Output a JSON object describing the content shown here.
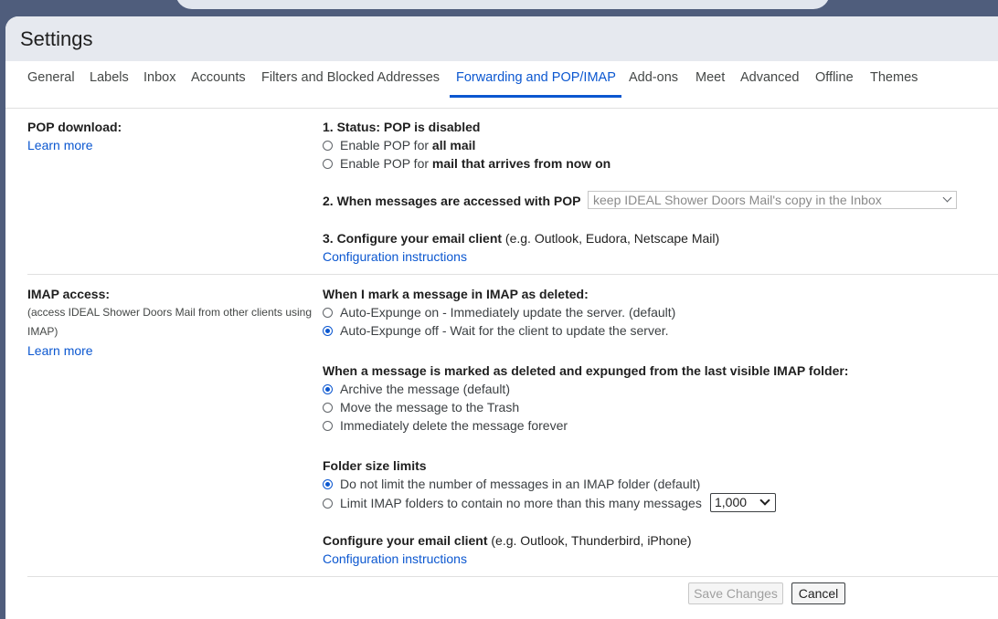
{
  "header": {
    "title": "Settings"
  },
  "tabs": [
    {
      "label": "General"
    },
    {
      "label": "Labels"
    },
    {
      "label": "Inbox"
    },
    {
      "label": "Accounts"
    },
    {
      "label": "Filters and Blocked Addresses"
    },
    {
      "label": "Forwarding and POP/IMAP",
      "active": true
    },
    {
      "label": "Add-ons"
    },
    {
      "label": "Meet"
    },
    {
      "label": "Advanced"
    },
    {
      "label": "Offline"
    },
    {
      "label": "Themes"
    }
  ],
  "pop": {
    "label": "POP download:",
    "learn_more": "Learn more",
    "status": "1. Status: POP is disabled",
    "option_all_prefix": "Enable POP for ",
    "option_all_bold": "all mail",
    "option_new_prefix": "Enable POP for ",
    "option_new_bold": "mail that arrives from now on",
    "access_label": "2. When messages are accessed with POP",
    "access_select": "keep IDEAL Shower Doors Mail's copy in the Inbox",
    "configure_bold": "3. Configure your email client",
    "configure_rest": " (e.g. Outlook, Eudora, Netscape Mail)",
    "config_link": "Configuration instructions"
  },
  "imap": {
    "label": "IMAP access:",
    "sub": "(access IDEAL Shower Doors Mail from other clients using IMAP)",
    "learn_more": "Learn more",
    "deleted_heading": "When I mark a message in IMAP as deleted:",
    "expunge_on": "Auto-Expunge on - Immediately update the server. (default)",
    "expunge_off": "Auto-Expunge off - Wait for the client to update the server.",
    "expunged_heading": "When a message is marked as deleted and expunged from the last visible IMAP folder:",
    "archive": "Archive the message (default)",
    "trash": "Move the message to the Trash",
    "delete_forever": "Immediately delete the message forever",
    "folder_heading": "Folder size limits",
    "no_limit": "Do not limit the number of messages in an IMAP folder (default)",
    "limit": "Limit IMAP folders to contain no more than this many messages",
    "limit_value": "1,000",
    "configure_bold": "Configure your email client",
    "configure_rest": " (e.g. Outlook, Thunderbird, iPhone)",
    "config_link": "Configuration instructions"
  },
  "footer": {
    "save": "Save Changes",
    "cancel": "Cancel"
  }
}
